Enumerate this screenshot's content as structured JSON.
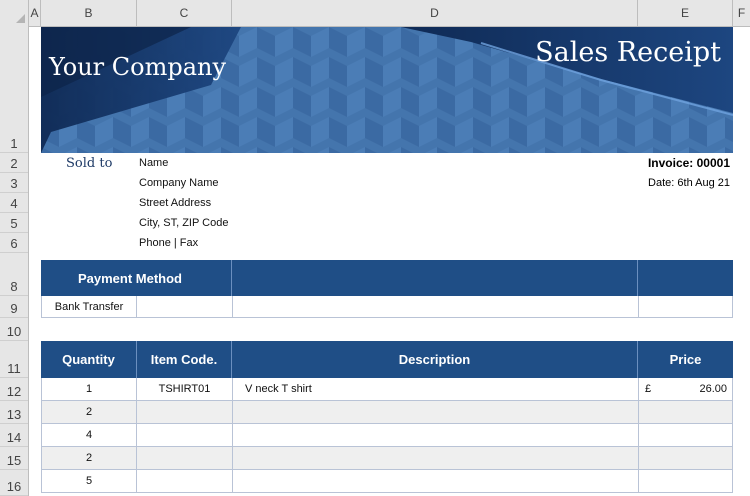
{
  "sheet": {
    "columns": [
      "A",
      "B",
      "C",
      "D",
      "E",
      "F"
    ],
    "rows": [
      "1",
      "2",
      "3",
      "4",
      "5",
      "6",
      "8",
      "9",
      "10",
      "11",
      "12",
      "13",
      "14",
      "15",
      "16"
    ]
  },
  "banner": {
    "company": "Your Company",
    "title": "Sales Receipt"
  },
  "sold_to": {
    "label": "Sold to",
    "lines": [
      "Name",
      "Company Name",
      "Street Address",
      "City, ST,  ZIP Code",
      "Phone  |  Fax"
    ]
  },
  "invoice": {
    "number": "Invoice: 00001",
    "date": "Date: 6th Aug 21"
  },
  "payment": {
    "header": "Payment Method",
    "value": "Bank Transfer"
  },
  "items": {
    "headers": [
      "Quantity",
      "Item Code.",
      "Description",
      "Price"
    ],
    "rows": [
      {
        "qty": "1",
        "code": "TSHIRT01",
        "desc": "V neck T shirt",
        "currency": "£",
        "price": "26.00"
      },
      {
        "qty": "2",
        "code": "",
        "desc": "",
        "currency": "",
        "price": ""
      },
      {
        "qty": "4",
        "code": "",
        "desc": "",
        "currency": "",
        "price": ""
      },
      {
        "qty": "2",
        "code": "",
        "desc": "",
        "currency": "",
        "price": ""
      },
      {
        "qty": "5",
        "code": "",
        "desc": "",
        "currency": "",
        "price": ""
      }
    ]
  },
  "colors": {
    "header_blue": "#1f4e86",
    "banner_blue": "#3d6ea8",
    "stripe_gray": "#efefef"
  }
}
